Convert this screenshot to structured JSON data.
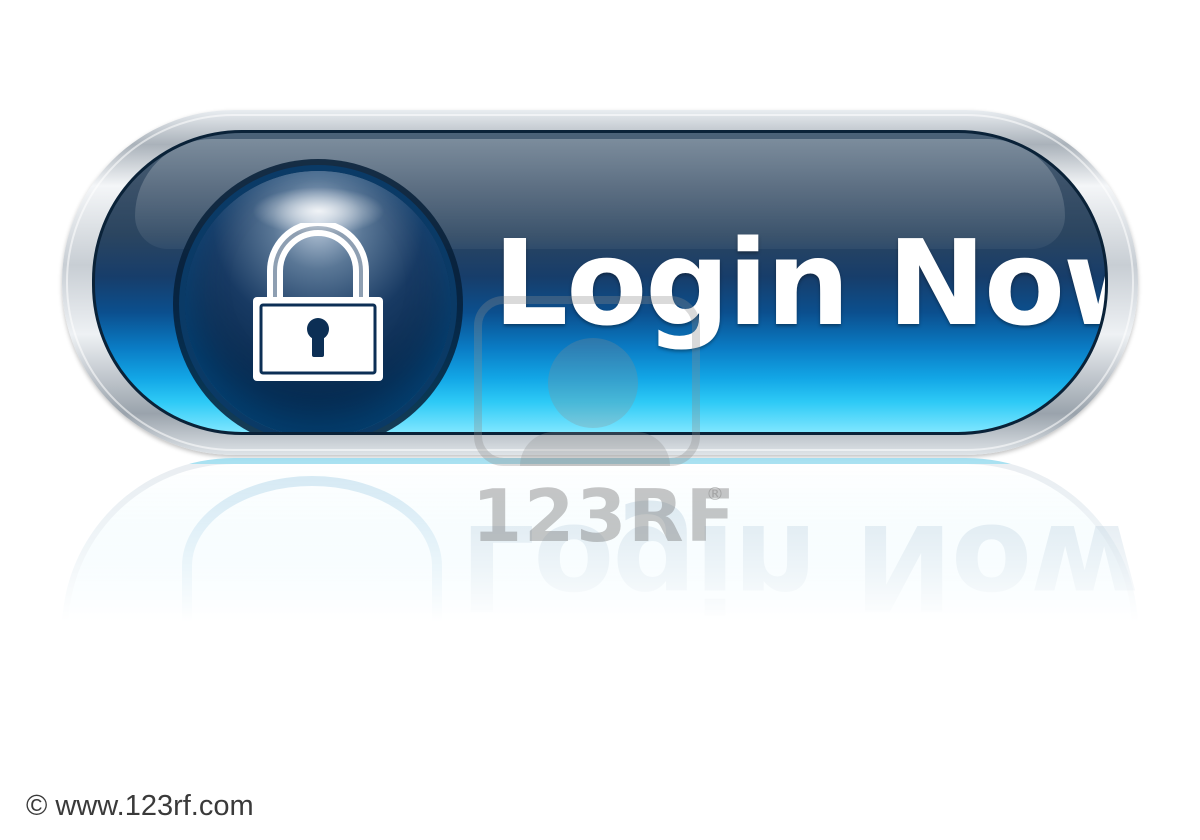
{
  "button": {
    "label": "Login Now",
    "icon": "lock-icon",
    "colors": {
      "body_top": "#3a5068",
      "body_bottom": "#2ecaf6",
      "label": "#ffffff",
      "frame": "#c8ced4"
    }
  },
  "watermark": {
    "text": "123RF",
    "registered_mark": "®",
    "icon": "camera-person-icon"
  },
  "credit": {
    "text": "© www.123rf.com"
  }
}
